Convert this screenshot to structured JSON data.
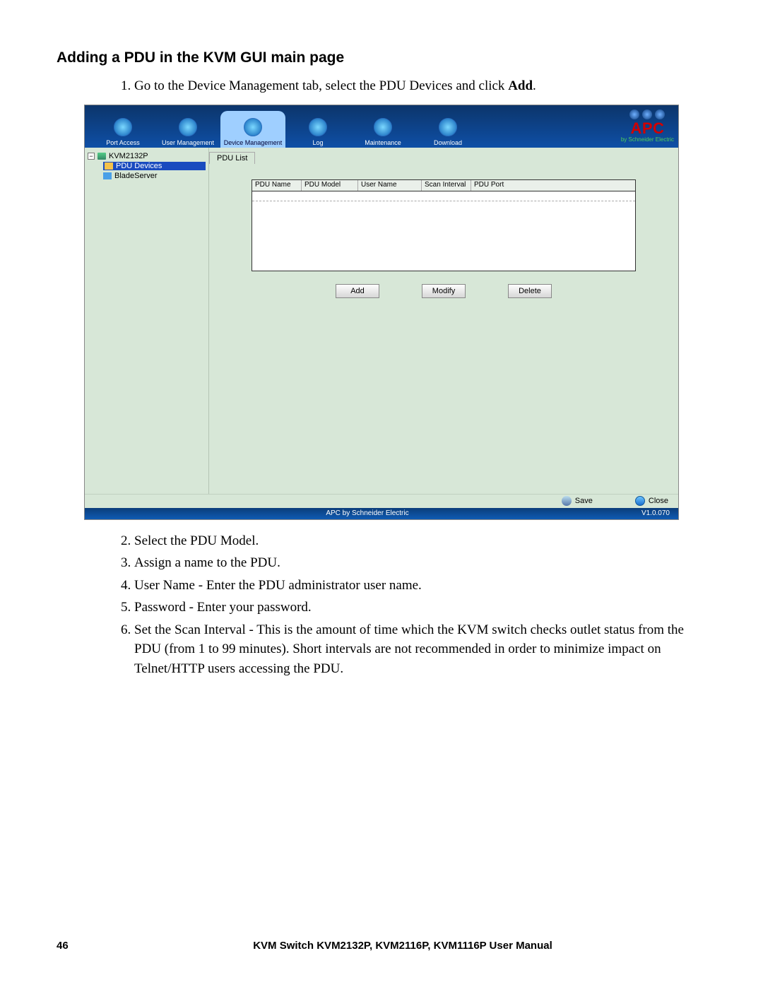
{
  "heading": "Adding a PDU in the KVM GUI main page",
  "steps": {
    "s1_pre": "Go to the Device Management tab, select the PDU Devices and click ",
    "s1_bold": "Add",
    "s1_post": ".",
    "s2": "Select the PDU Model.",
    "s3": "Assign a name to the PDU.",
    "s4": "User Name - Enter the PDU administrator user name.",
    "s5": "Password - Enter your password.",
    "s6": "Set the Scan Interval - This is the amount of time which the KVM switch checks outlet status from the PDU (from 1 to 99 minutes). Short intervals are not recommended in order to minimize impact on Telnet/HTTP users accessing the PDU."
  },
  "nav": {
    "tabs": [
      "Port Access",
      "User Management",
      "Device Management",
      "Log",
      "Maintenance",
      "Download"
    ]
  },
  "logo": {
    "brand": "APC",
    "sub": "by Schneider Electric"
  },
  "tree": {
    "root": "KVM2132P",
    "items": [
      "PDU Devices",
      "BladeServer"
    ]
  },
  "subtab": "PDU List",
  "columns": [
    "PDU Name",
    "PDU Model",
    "User Name",
    "Scan Interval",
    "PDU Port"
  ],
  "buttons": {
    "add": "Add",
    "modify": "Modify",
    "delete": "Delete"
  },
  "bottom": {
    "save": "Save",
    "close": "Close"
  },
  "status": {
    "center": "APC by Schneider Electric",
    "right": "V1.0.070"
  },
  "footer": {
    "page": "46",
    "book": "KVM Switch KVM2132P, KVM2116P, KVM1116P User Manual"
  }
}
